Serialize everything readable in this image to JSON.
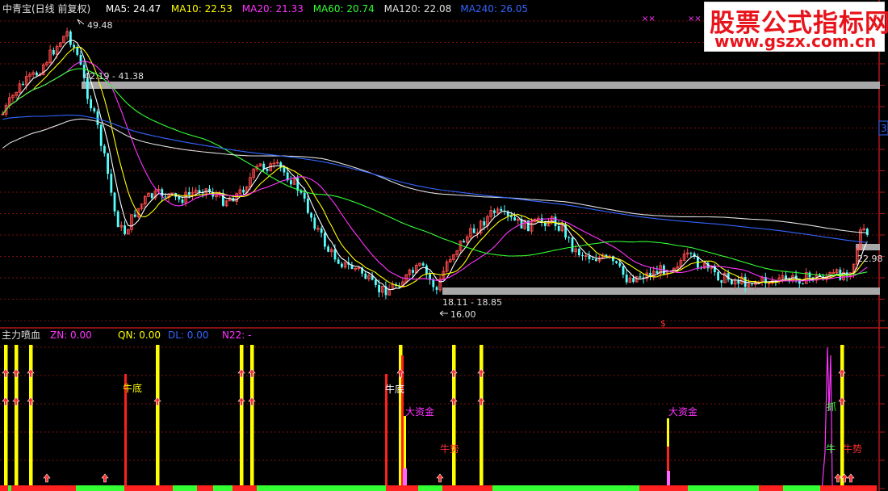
{
  "upper_panel": {
    "header": [
      {
        "text": "中青宝(日线 前复权)",
        "color": "#e0e0e0"
      },
      {
        "text": "MA5: 24.47",
        "color": "#ffffff"
      },
      {
        "text": "MA10: 22.53",
        "color": "#ffff00"
      },
      {
        "text": "MA20: 21.33",
        "color": "#ff33ff"
      },
      {
        "text": "MA60: 20.74",
        "color": "#33ff33"
      },
      {
        "text": "MA120: 22.08",
        "color": "#e0e0e0"
      },
      {
        "text": "MA240: 26.05",
        "color": "#3366ff"
      }
    ],
    "annotations": {
      "high": "49.48",
      "upper_range": "42.19 - 41.38",
      "lower_range": "18.11 - 18.85",
      "low": "16.00",
      "last_price": "22.98",
      "right_badge": "3",
      "top_marks": "××",
      "signal_mark": "$"
    }
  },
  "lower_panel": {
    "header": [
      {
        "text": "主力喷血",
        "color": "#e0e0e0"
      },
      {
        "text": "ZN: 0.00",
        "color": "#ff33ff"
      },
      {
        "text": "QN: 0.00",
        "color": "#ffff00"
      },
      {
        "text": "DL: 0.00",
        "color": "#3366ff"
      },
      {
        "text": "N22: -",
        "color": "#ff33ff"
      }
    ],
    "labels": {
      "niu_di_1": "牛底",
      "niu_di_2": "牛底",
      "da_zi_jin_1": "大资金",
      "da_zi_jin_2": "大资金",
      "niu_shi_1": "牛势",
      "niu_shi_2": "牛势",
      "zhua": "抓",
      "niu": "牛"
    }
  },
  "watermark": {
    "line1": "股票公式指标网",
    "line2": "www.gszx.com.cn"
  },
  "chart_data": {
    "type": "line",
    "title": "中青宝(日线 前复权)",
    "series": [
      {
        "name": "MA5",
        "last": 24.47,
        "color": "#ffffff"
      },
      {
        "name": "MA10",
        "last": 22.53,
        "color": "#ffff00"
      },
      {
        "name": "MA20",
        "last": 21.33,
        "color": "#ff33ff"
      },
      {
        "name": "MA60",
        "last": 20.74,
        "color": "#33ff33"
      },
      {
        "name": "MA120",
        "last": 22.08,
        "color": "#e0e0e0"
      },
      {
        "name": "MA240",
        "last": 26.05,
        "color": "#3366ff"
      }
    ],
    "price_high": 49.48,
    "price_low": 16.0,
    "last_price": 22.98,
    "support_zone": [
      18.11,
      18.85
    ],
    "resistance_zone": [
      42.19,
      41.38
    ],
    "indicator": {
      "name": "主力喷血",
      "ZN": 0.0,
      "QN": 0.0,
      "DL": 0.0,
      "N22": "-"
    },
    "grid": true
  }
}
